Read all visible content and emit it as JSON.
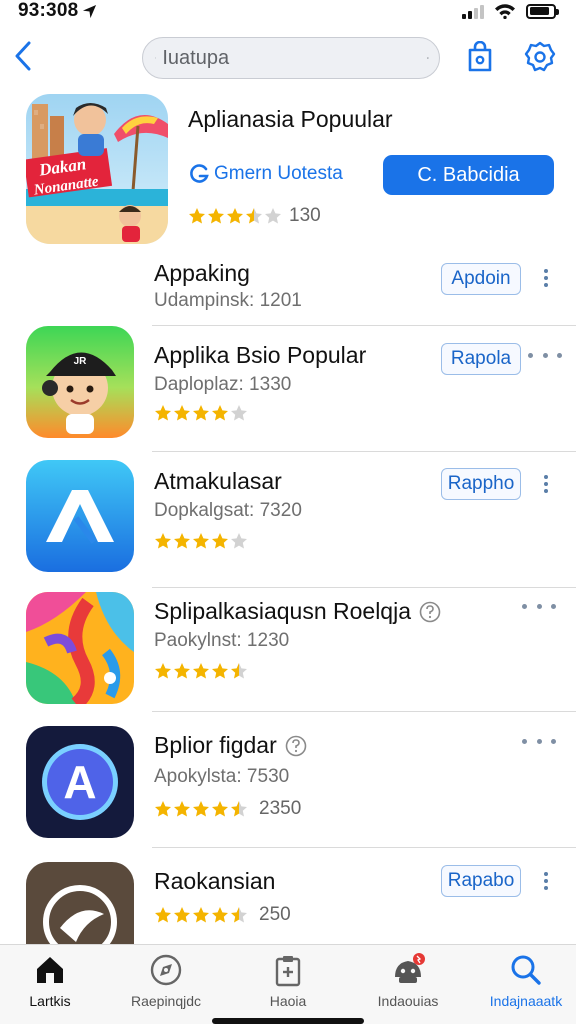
{
  "status_bar": {
    "time": "93:308",
    "battery_level": 0.85
  },
  "search": {
    "placeholder": "Iuatupa"
  },
  "featured": {
    "art_line1": "Dakan",
    "art_line2": "Nonanatte",
    "title": "Aplianasia Popuular",
    "subtitle": "Gmern Uotesta",
    "cta_label": "C. Babcidia",
    "rating": 3.5,
    "rating_count": "130"
  },
  "apps": [
    {
      "name": "Appaking",
      "meta": "Udampinsk: 1201",
      "button": "Apdoin"
    },
    {
      "name": "Applika Bsio Popular",
      "meta": "Daploplaz: 1330",
      "rating": 4,
      "button": "Rapola",
      "icon_text": "JR"
    },
    {
      "name": "Atmakulasar",
      "meta": "Dopkalgsat: 7320",
      "rating": 4,
      "button": "Rappho"
    },
    {
      "name": "Splipalkasiaqusn Roelqja",
      "meta": "Paokylnst: 1230",
      "rating": 4.5
    },
    {
      "name": "Bplior figdar",
      "meta": "Apokylsta: 7530",
      "rating": 4.5,
      "rating_count": "2350",
      "icon_letter": "A"
    },
    {
      "name": "Raokansian",
      "rating": 4.5,
      "rating_count": "250",
      "button": "Rapabo"
    }
  ],
  "tabs": [
    {
      "label": "Lartkis",
      "icon": "home-icon",
      "active": false
    },
    {
      "label": "Raepinqjdc",
      "icon": "compass-icon",
      "active": false
    },
    {
      "label": "Haoia",
      "icon": "clipboard-icon",
      "active": false
    },
    {
      "label": "Indaouias",
      "icon": "badge-icon",
      "active": false
    },
    {
      "label": "Indajnaaatk",
      "icon": "search-icon",
      "active": true
    }
  ],
  "colors": {
    "accent": "#1a73e8",
    "star": "#f4b400",
    "star_empty": "#d2d2d2"
  }
}
